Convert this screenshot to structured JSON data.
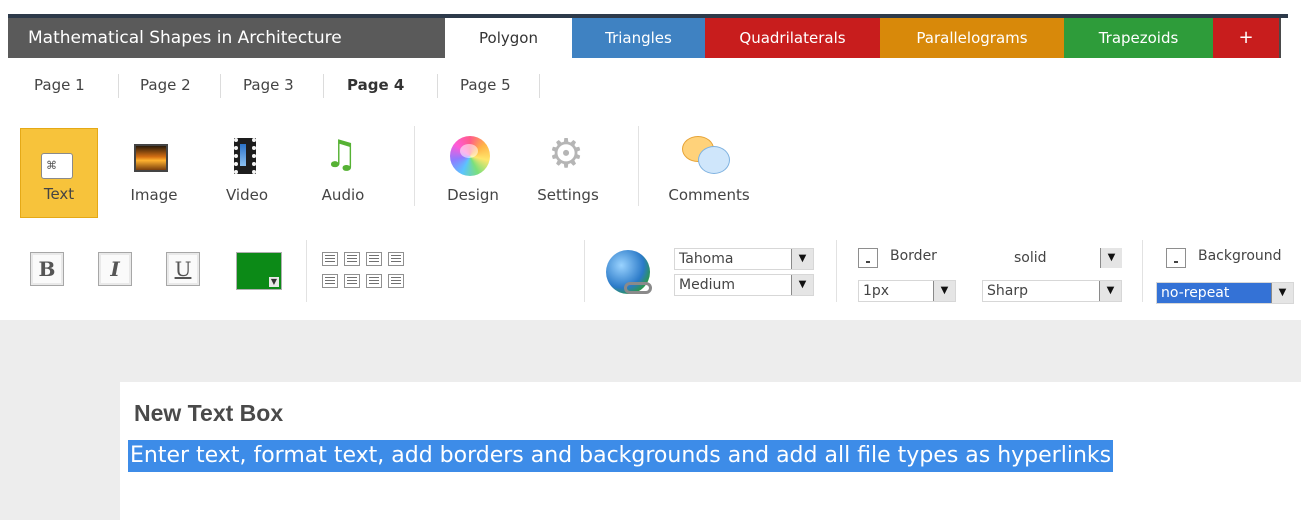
{
  "app": {
    "title": "Mathematical Shapes in Architecture"
  },
  "tabs": [
    {
      "label": "Polygon",
      "color": "#ffffff",
      "active": true
    },
    {
      "label": "Triangles",
      "color": "#3f82c2"
    },
    {
      "label": "Quadrilaterals",
      "color": "#c81d1d"
    },
    {
      "label": "Parallelograms",
      "color": "#d8890a"
    },
    {
      "label": "Trapezoids",
      "color": "#2e9c3a"
    },
    {
      "label": "+",
      "color": "#c81d1d"
    }
  ],
  "pages": [
    {
      "label": "Page 1"
    },
    {
      "label": "Page 2"
    },
    {
      "label": "Page 3"
    },
    {
      "label": "Page 4",
      "current": true
    },
    {
      "label": "Page 5"
    }
  ],
  "insert_tools": [
    {
      "label": "Text",
      "icon": "text-box-icon",
      "active": true
    },
    {
      "label": "Image",
      "icon": "image-icon"
    },
    {
      "label": "Video",
      "icon": "film-strip-icon"
    },
    {
      "label": "Audio",
      "icon": "music-note-icon"
    },
    {
      "label": "Design",
      "icon": "color-wheel-icon"
    },
    {
      "label": "Settings",
      "icon": "gear-icon"
    },
    {
      "label": "Comments",
      "icon": "speech-bubbles-icon"
    }
  ],
  "text_icon_glyph": "⌘",
  "format": {
    "bold": "B",
    "italic": "I",
    "underline": "U",
    "font_color": "#0c8a17",
    "font_family": "Tahoma",
    "font_size": "Medium",
    "border_label": "Border",
    "border_style": "solid",
    "border_width": "1px",
    "border_corners": "Sharp",
    "background_label": "Background",
    "background_repeat": "no-repeat"
  },
  "dropdown_arrow": "▼",
  "textbox": {
    "title": "New Text Box",
    "body": "Enter text, format text, add borders and backgrounds and add all file types as hyperlinks"
  }
}
